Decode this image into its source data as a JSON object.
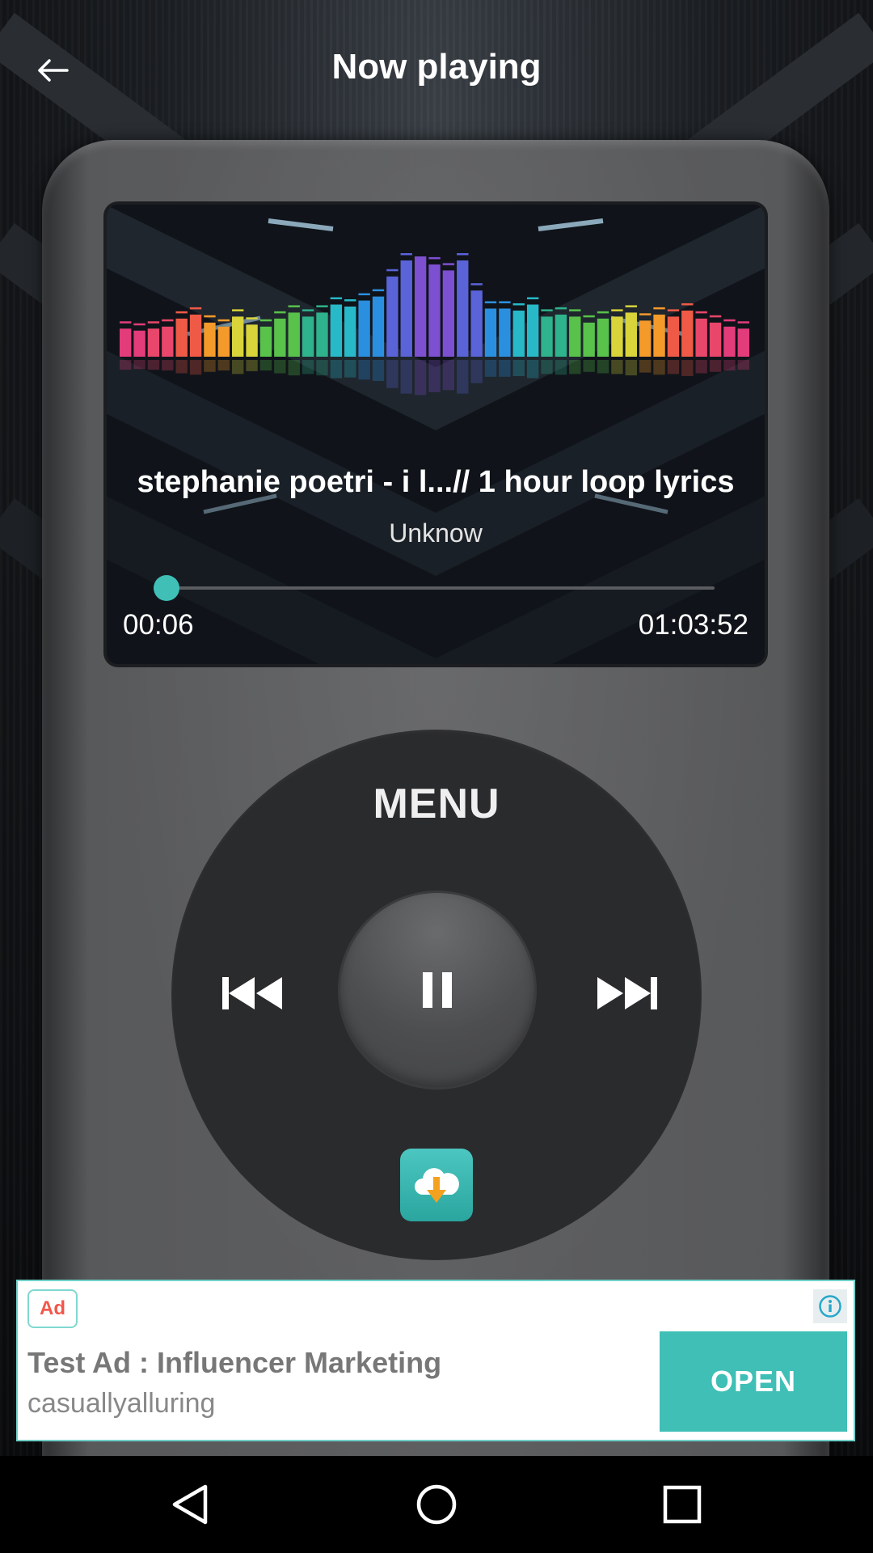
{
  "header": {
    "title": "Now playing",
    "back_icon": "arrow-left-icon"
  },
  "player": {
    "track_title": "stephanie poetri - i l...// 1 hour loop lyrics",
    "artist": "Unknow",
    "elapsed": "00:06",
    "duration": "01:03:52",
    "progress_fraction": 0.0016,
    "accent_color": "#3fbfb6",
    "equalizer_levels": [
      0.28,
      0.26,
      0.28,
      0.3,
      0.38,
      0.42,
      0.34,
      0.3,
      0.4,
      0.32,
      0.3,
      0.38,
      0.44,
      0.4,
      0.44,
      0.52,
      0.5,
      0.56,
      0.6,
      0.8,
      0.96,
      1.0,
      0.92,
      0.86,
      0.96,
      0.66,
      0.48,
      0.48,
      0.46,
      0.52,
      0.4,
      0.42,
      0.4,
      0.34,
      0.38,
      0.4,
      0.44,
      0.36,
      0.42,
      0.4,
      0.46,
      0.38,
      0.34,
      0.3,
      0.28
    ]
  },
  "wheel": {
    "menu_label": "MENU",
    "prev_icon": "skip-previous-icon",
    "next_icon": "skip-next-icon",
    "center_icon": "pause-icon",
    "download_icon": "cloud-download-icon"
  },
  "ad": {
    "badge": "Ad",
    "title": "Test Ad : Influencer Marketing",
    "subtitle": "casuallyalluring",
    "cta": "OPEN",
    "info_icon": "info-icon"
  },
  "navbar": {
    "back_icon": "nav-back-icon",
    "home_icon": "nav-home-icon",
    "recents_icon": "nav-recents-icon"
  }
}
